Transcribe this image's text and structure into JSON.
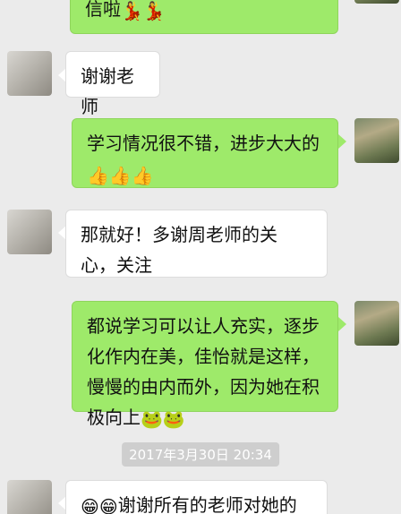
{
  "messages": [
    {
      "id": "m0",
      "side": "out",
      "text": "信啦",
      "emoji": "💃💃"
    },
    {
      "id": "m1",
      "side": "in",
      "text": "谢谢老师",
      "emoji": ""
    },
    {
      "id": "m2",
      "side": "out",
      "text": "学习情况很不错，进步大大的",
      "emoji": "👍👍👍"
    },
    {
      "id": "m3",
      "side": "in",
      "text": "那就好！多谢周老师的关心，关注",
      "emoji": ""
    },
    {
      "id": "m4",
      "side": "out",
      "text": "都说学习可以让人充实，逐步化作内在美，佳怡就是这样，慢慢的由内而外，因为她在积极向上",
      "emoji": "🐸🐸"
    },
    {
      "id": "m5",
      "side": "in",
      "text": "谢谢所有的老师对她的",
      "emoji_before": "😁😁"
    }
  ],
  "timestamp": "2017年3月30日 20:34"
}
